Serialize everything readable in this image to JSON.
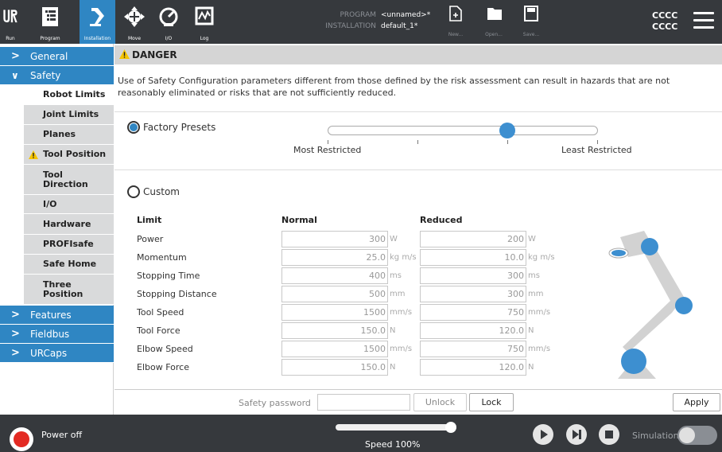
{
  "topbar": {
    "run": "Run",
    "program": "Program",
    "installation": "Installation",
    "move": "Move",
    "io": "I/O",
    "log": "Log",
    "program_key": "PROGRAM",
    "program_val": "<unnamed>*",
    "installation_key": "INSTALLATION",
    "installation_val": "default_1*",
    "new": "New...",
    "open": "Open...",
    "save": "Save...",
    "user_line1": "CCCC",
    "user_line2": "CCCC"
  },
  "sidebar": {
    "general": "General",
    "safety": "Safety",
    "items": [
      "Robot Limits",
      "Joint Limits",
      "Planes",
      "Tool Position",
      "Tool Direction",
      "I/O",
      "Hardware",
      "PROFIsafe",
      "Safe Home",
      "Three Position"
    ],
    "features": "Features",
    "fieldbus": "Fieldbus",
    "urcaps": "URCaps"
  },
  "danger": {
    "title": "DANGER",
    "text": "Use of Safety Configuration parameters different from those defined by the risk assessment can result in hazards that are not reasonably eliminated or risks that are not sufficiently reduced."
  },
  "presets": {
    "factory_label": "Factory Presets",
    "most": "Most Restricted",
    "least": "Least Restricted",
    "custom_label": "Custom"
  },
  "table": {
    "header_limit": "Limit",
    "header_normal": "Normal",
    "header_reduced": "Reduced",
    "rows": [
      {
        "label": "Power",
        "normal": "300",
        "reduced": "200",
        "unit": "W"
      },
      {
        "label": "Momentum",
        "normal": "25.0",
        "reduced": "10.0",
        "unit": "kg m/s"
      },
      {
        "label": "Stopping Time",
        "normal": "400",
        "reduced": "300",
        "unit": "ms"
      },
      {
        "label": "Stopping Distance",
        "normal": "500",
        "reduced": "300",
        "unit": "mm"
      },
      {
        "label": "Tool Speed",
        "normal": "1500",
        "reduced": "750",
        "unit": "mm/s"
      },
      {
        "label": "Tool Force",
        "normal": "150.0",
        "reduced": "120.0",
        "unit": "N"
      },
      {
        "label": "Elbow Speed",
        "normal": "1500",
        "reduced": "750",
        "unit": "mm/s"
      },
      {
        "label": "Elbow Force",
        "normal": "150.0",
        "reduced": "120.0",
        "unit": "N"
      }
    ]
  },
  "actions": {
    "password_label": "Safety password",
    "unlock": "Unlock",
    "lock": "Lock",
    "apply": "Apply"
  },
  "footer": {
    "power": "Power off",
    "speed": "Speed 100%",
    "simulation": "Simulation"
  },
  "colors": {
    "accent": "#2f86c3",
    "dark_bar": "#36393d",
    "power_red": "#e32a23"
  }
}
